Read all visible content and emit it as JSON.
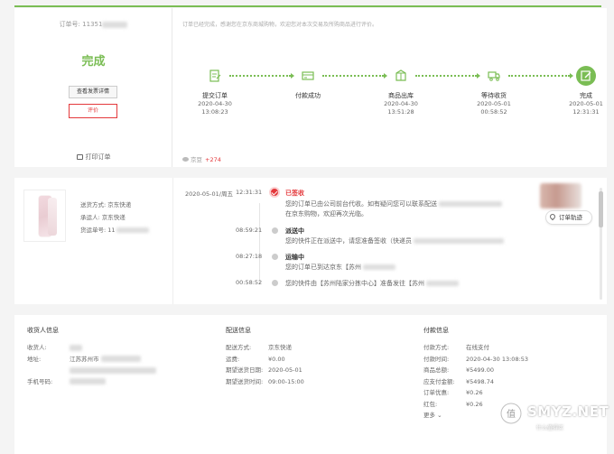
{
  "header": {
    "order_no_label": "订单号:",
    "order_no_prefix": "11351",
    "status": "完成",
    "invoice_button": "查看发票详情",
    "review_button": "评价",
    "print_label": "打印订单",
    "notice": "订单已经完成，感谢您在京东商城购物，欢迎您对本次交易及所购商品进行评价。",
    "bean_label": "京豆",
    "bean_value": "+274"
  },
  "steps": [
    {
      "name": "提交订单",
      "date": "2020-04-30",
      "time": "13:08:23",
      "icon": "submit-order-icon"
    },
    {
      "name": "付款成功",
      "date": "",
      "time": "",
      "icon": "payment-icon"
    },
    {
      "name": "商品出库",
      "date": "2020-04-30",
      "time": "13:51:28",
      "icon": "warehouse-icon"
    },
    {
      "name": "等待收货",
      "date": "2020-05-01",
      "time": "00:58:52",
      "icon": "truck-icon"
    },
    {
      "name": "完成",
      "date": "2020-05-01",
      "time": "12:31:31",
      "icon": "complete-icon"
    }
  ],
  "shipment": {
    "method_label": "送货方式:",
    "method_value": "京东快递",
    "carrier_label": "承运人:",
    "carrier_value": "京东快递",
    "tracking_label": "货运单号:",
    "tracking_prefix": "11"
  },
  "tracking": [
    {
      "date": "2020-05-01/周五",
      "time": "12:31:31",
      "title": "已签收",
      "desc1": "您的订单已由公司前台代收。如有疑问您可以联系配送",
      "desc2": "在京东购物，欢迎再次光临。"
    },
    {
      "date": "",
      "time": "08:59:21",
      "title": "派送中",
      "desc1": "您的快件正在派送中，请您准备签收（快递员",
      "desc2": ""
    },
    {
      "date": "",
      "time": "08:27:18",
      "title": "运输中",
      "desc1": "您的订单已到达京东【苏州",
      "desc2": ""
    },
    {
      "date": "",
      "time": "00:58:52",
      "title": "",
      "desc1": "您的快件由【苏州陆家分拣中心】准备发往【苏州",
      "desc2": ""
    }
  ],
  "track_button": "订单轨迹",
  "receiver": {
    "title": "收货人信息",
    "name_label": "收货人:",
    "address_label": "地址:",
    "address_prefix": "江苏苏州市",
    "phone_label": "手机号码:"
  },
  "delivery": {
    "title": "配送信息",
    "rows": [
      {
        "k": "配送方式:",
        "v": "京东快递"
      },
      {
        "k": "运费:",
        "v": "¥0.00"
      },
      {
        "k": "期望送货日期:",
        "v": "2020-05-01"
      },
      {
        "k": "期望送货时间:",
        "v": "09:00-15:00"
      }
    ]
  },
  "payment": {
    "title": "付款信息",
    "rows": [
      {
        "k": "付款方式:",
        "v": "在线支付"
      },
      {
        "k": "付款时间:",
        "v": "2020-04-30 13:08:53"
      },
      {
        "k": "商品总额:",
        "v": "¥5499.00"
      },
      {
        "k": "应支付金额:",
        "v": "¥5498.74"
      },
      {
        "k": "订单优惠:",
        "v": "¥0.26"
      },
      {
        "k": "红包:",
        "v": "¥0.26"
      }
    ],
    "more": "更多"
  },
  "watermark": {
    "text": "SMYZ.NET",
    "sub": "什么值得买"
  },
  "colors": {
    "accent_green": "#7abd54",
    "accent_red": "#e4393c"
  }
}
